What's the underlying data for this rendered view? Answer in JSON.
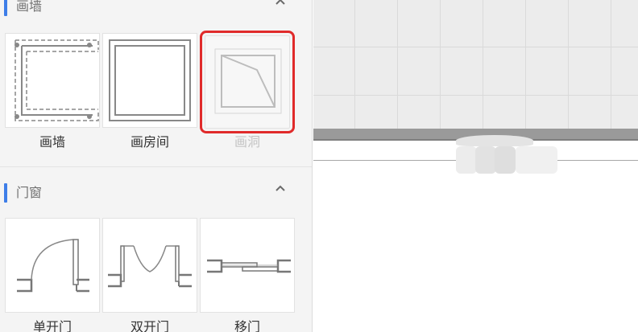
{
  "sidebar": {
    "accent_color": "#3e7ee8",
    "sections": [
      {
        "title": "画墙",
        "collapse_icon": "chevron-up-icon",
        "tools": [
          {
            "label": "画墙",
            "icon": "draw-wall-icon",
            "state": "normal"
          },
          {
            "label": "画房间",
            "icon": "draw-room-icon",
            "state": "normal"
          },
          {
            "label": "画洞",
            "icon": "draw-opening-icon",
            "state": "disabled",
            "highlighted": true,
            "highlight_color": "#e02a2a"
          }
        ]
      },
      {
        "title": "门窗",
        "collapse_icon": "chevron-up-icon",
        "tools": [
          {
            "label": "单开门",
            "icon": "single-door-icon",
            "state": "normal"
          },
          {
            "label": "双开门",
            "icon": "double-door-icon",
            "state": "normal"
          },
          {
            "label": "移门",
            "icon": "sliding-door-icon",
            "state": "normal"
          }
        ]
      }
    ]
  },
  "canvas": {
    "grid_color": "#dadada",
    "background_color": "#ececec",
    "wall_color": "#9a9a9a"
  }
}
